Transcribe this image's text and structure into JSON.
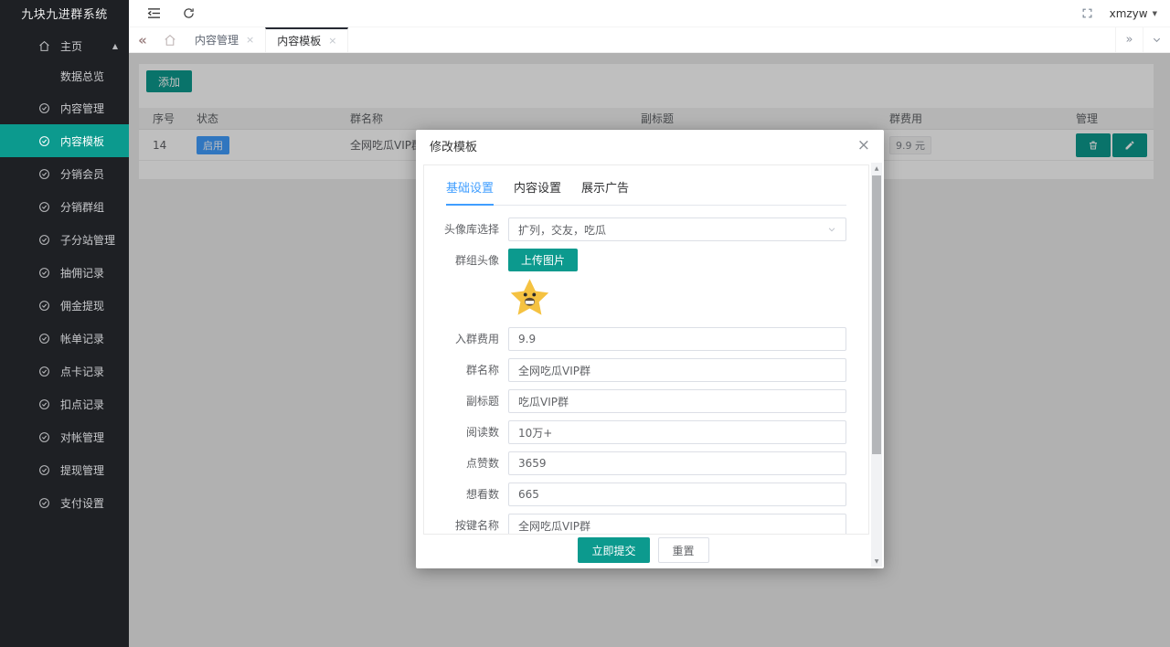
{
  "colors": {
    "accent": "#0c9a8e",
    "status_blue": "#409eff",
    "tab_active_blue": "#409eff",
    "sidebar_bg": "#1e2024"
  },
  "icons": {
    "chevrons_left": "«",
    "chevrons_right": "»",
    "tab_close": "×",
    "modal_close": "×",
    "caret_up": "▲",
    "caret_down": "▼",
    "scroll_up": "▲",
    "scroll_down": "▼"
  },
  "sidebar": {
    "title": "九块九进群系统",
    "home": {
      "label": "主页"
    },
    "home_sub": {
      "label": "数据总览"
    },
    "items": [
      {
        "label": "内容管理"
      },
      {
        "label": "内容模板"
      },
      {
        "label": "分销会员"
      },
      {
        "label": "分销群组"
      },
      {
        "label": "子分站管理"
      },
      {
        "label": "抽佣记录"
      },
      {
        "label": "佣金提现"
      },
      {
        "label": "帐单记录"
      },
      {
        "label": "点卡记录"
      },
      {
        "label": "扣点记录"
      },
      {
        "label": "对帐管理"
      },
      {
        "label": "提现管理"
      },
      {
        "label": "支付设置"
      }
    ]
  },
  "navbar": {
    "user": "xmzyw"
  },
  "tabbar": {
    "tabs": [
      {
        "label": "内容管理"
      },
      {
        "label": "内容模板"
      }
    ]
  },
  "content": {
    "add_button": "添加",
    "table": {
      "headers": [
        "序号",
        "状态",
        "群名称",
        "副标题",
        "群费用",
        "管理"
      ],
      "row": {
        "seq": "14",
        "status": "启用",
        "group_name": "全网吃瓜VIP群",
        "subtitle": "",
        "fee": "9.9 元"
      }
    }
  },
  "modal": {
    "title": "修改模板",
    "tabs": [
      "基础设置",
      "内容设置",
      "展示广告"
    ],
    "fields": [
      {
        "label": "头像库选择",
        "value": "扩列，交友，吃瓜"
      },
      {
        "label": "群组头像",
        "button": "上传图片"
      },
      {
        "label": "入群费用",
        "value": "9.9"
      },
      {
        "label": "群名称",
        "value": "全网吃瓜VIP群"
      },
      {
        "label": "副标题",
        "value": "吃瓜VIP群"
      },
      {
        "label": "阅读数",
        "value": "10万+"
      },
      {
        "label": "点赞数",
        "value": "3659"
      },
      {
        "label": "想看数",
        "value": "665"
      },
      {
        "label": "按键名称",
        "value": "全网吃瓜VIP群"
      }
    ],
    "submit_label": "立即提交",
    "reset_label": "重置"
  }
}
